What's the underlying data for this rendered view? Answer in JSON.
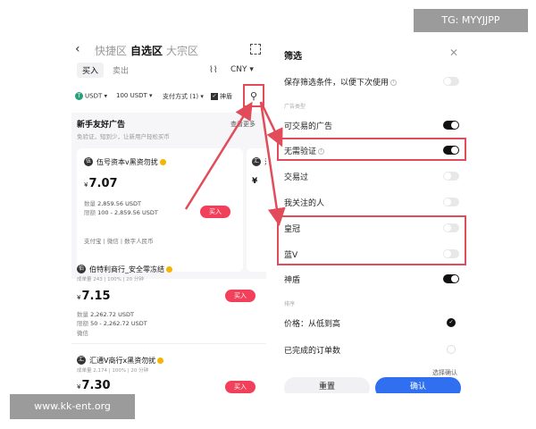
{
  "left_screen": {
    "tabs": [
      "快捷区",
      "自选区",
      "大宗区"
    ],
    "active_tab": "自选区",
    "buy_tab": "买入",
    "sell_tab": "卖出",
    "currency": "CNY",
    "filters": {
      "coin": "USDT",
      "amount": "100 USDT",
      "payment": "支付方式 (1)",
      "shield": "神盾"
    },
    "promo": {
      "title": "新手友好广告",
      "subtitle": "免验证，短到少，让新用户轻松买币",
      "more": "查看更多"
    },
    "cards": [
      {
        "merchant": "伍号资本v黑资勿扰",
        "price": "7.07",
        "currency_symbol": "¥",
        "quantity_label": "数量",
        "quantity": "2,859.56 USDT",
        "limit_label": "限额",
        "limit": "100 - 2,859.56 USDT",
        "payments": "支付宝 | 微信 | 数字人民币",
        "buy": "买入"
      },
      {
        "merchant": "汇",
        "price": ""
      }
    ],
    "listings": [
      {
        "merchant": "伯特利商行_安全零冻结",
        "stats": "成单量 243 | 100% | 20 分钟",
        "price": "7.15",
        "currency_symbol": "¥",
        "quantity_label": "数量",
        "quantity": "2,262.72 USDT",
        "limit_label": "限额",
        "limit": "50 - 2,262.72 USDT",
        "payments": "微信",
        "buy": "买入"
      },
      {
        "merchant": "汇通V商行x黑资勿扰",
        "stats": "成单量 2,174 | 100% | 20 分钟",
        "price": "7.30",
        "currency_symbol": "¥",
        "buy": "买入"
      }
    ]
  },
  "filter_panel": {
    "title": "筛选",
    "save_label": "保存筛选条件，以便下次使用",
    "ad_type_section": "广告类型",
    "items": [
      {
        "label": "可交易的广告",
        "on": true
      },
      {
        "label": "无需验证",
        "on": true,
        "info": true
      },
      {
        "label": "交易过",
        "on": false
      },
      {
        "label": "我关注的人",
        "on": false
      },
      {
        "label": "皇冠",
        "on": false
      },
      {
        "label": "蓝V",
        "on": false
      },
      {
        "label": "神盾",
        "on": true
      }
    ],
    "sort_section": "排序",
    "sort_options": [
      {
        "label": "价格：从低到高",
        "selected": true
      },
      {
        "label": "已完成的订单数",
        "selected": false
      }
    ],
    "reset": "重置",
    "confirm": "确认",
    "corner_text": "选择确认"
  },
  "overlays": {
    "tg_tag": "TG: MYYJJPP",
    "site_tag": "www.kk-ent.org",
    "highlight_color": "#e24c5a"
  }
}
